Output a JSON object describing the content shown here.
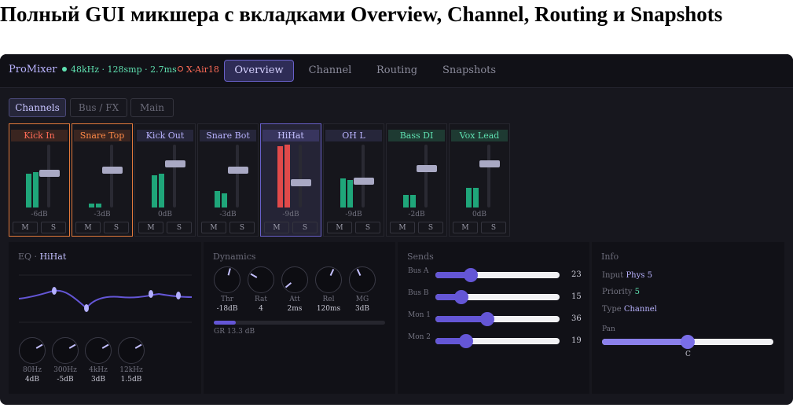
{
  "page_heading": "Полный GUI микшера с вкладками Overview, Channel, Routing и Snapshots",
  "app": {
    "brand": "ProMixer",
    "status": "48kHz · 128smp · 2.7ms",
    "device": "X-Air18",
    "tabs": [
      "Overview",
      "Channel",
      "Routing",
      "Snapshots"
    ],
    "active_tab": "Overview"
  },
  "subtabs": [
    "Channels",
    "Bus / FX",
    "Main"
  ],
  "colors": {
    "accent": "#6456d6",
    "meter_green": "#1fa67a",
    "meter_red": "#e14a4a",
    "orange": "#e2793b",
    "teal": "#5fe0b0"
  },
  "channels": [
    {
      "name": "Kick In",
      "db": "-6dB",
      "color": "#ff6b57",
      "levels": [
        0.55,
        0.58
      ],
      "fader": 0.55,
      "mute": "M",
      "solo": "S"
    },
    {
      "name": "Snare Top",
      "db": "-3dB",
      "color": "#ff8a47",
      "levels": [
        0.07,
        0.07
      ],
      "fader": 0.6,
      "mute": "M",
      "solo": "S"
    },
    {
      "name": "Kick Out",
      "db": "0dB",
      "color": "#b9b3ff",
      "levels": [
        0.52,
        0.55
      ],
      "fader": 0.7,
      "mute": "M",
      "solo": "S"
    },
    {
      "name": "Snare Bot",
      "db": "-3dB",
      "color": "#b9b3ff",
      "levels": [
        0.27,
        0.23
      ],
      "fader": 0.6,
      "mute": "M",
      "solo": "S"
    },
    {
      "name": "HiHat",
      "db": "-9dB",
      "color": "#c4c0ff",
      "levels": [
        1.0,
        1.02
      ],
      "fader": 0.4,
      "mute": "M",
      "solo": "S"
    },
    {
      "name": "OH L",
      "db": "-9dB",
      "color": "#b9b3ff",
      "levels": [
        0.47,
        0.45
      ],
      "fader": 0.42,
      "mute": "M",
      "solo": "S"
    },
    {
      "name": "Bass DI",
      "db": "-2dB",
      "color": "#5fe0b0",
      "levels": [
        0.2,
        0.2
      ],
      "fader": 0.63,
      "mute": "M",
      "solo": "S"
    },
    {
      "name": "Vox Lead",
      "db": "0dB",
      "color": "#5fe0b0",
      "levels": [
        0.32,
        0.32
      ],
      "fader": 0.7,
      "mute": "M",
      "solo": "S"
    }
  ],
  "eq": {
    "title": "EQ",
    "channel": "HiHat",
    "bands": [
      {
        "freq": "80Hz",
        "gain": "4dB",
        "angle": 60
      },
      {
        "freq": "300Hz",
        "gain": "-5dB",
        "angle": 60
      },
      {
        "freq": "4kHz",
        "gain": "3dB",
        "angle": 60
      },
      {
        "freq": "12kHz",
        "gain": "1.5dB",
        "angle": 60
      }
    ]
  },
  "dynamics": {
    "title": "Dynamics",
    "knobs": [
      {
        "label": "Thr",
        "value": "-18dB",
        "angle": 15
      },
      {
        "label": "Rat",
        "value": "4",
        "angle": -60
      },
      {
        "label": "Att",
        "value": "2ms",
        "angle": -130
      },
      {
        "label": "Rel",
        "value": "120ms",
        "angle": 25
      },
      {
        "label": "MG",
        "value": "3dB",
        "angle": -25
      }
    ],
    "gr_text": "GR 13.3 dB",
    "gr_level": 0.13
  },
  "sends": {
    "title": "Sends",
    "items": [
      {
        "label": "Bus A",
        "value": "23",
        "level": 0.23
      },
      {
        "label": "Bus B",
        "value": "15",
        "level": 0.15
      },
      {
        "label": "Mon 1",
        "value": "36",
        "level": 0.36
      },
      {
        "label": "Mon 2",
        "value": "19",
        "level": 0.19
      }
    ]
  },
  "info": {
    "title": "Info",
    "input_label": "Input",
    "input_value": "Phys 5",
    "priority_label": "Priority",
    "priority_value": "5",
    "type_label": "Type",
    "type_value": "Channel",
    "pan_label": "Pan",
    "pan_value": "C",
    "pan_level": 0.5
  }
}
